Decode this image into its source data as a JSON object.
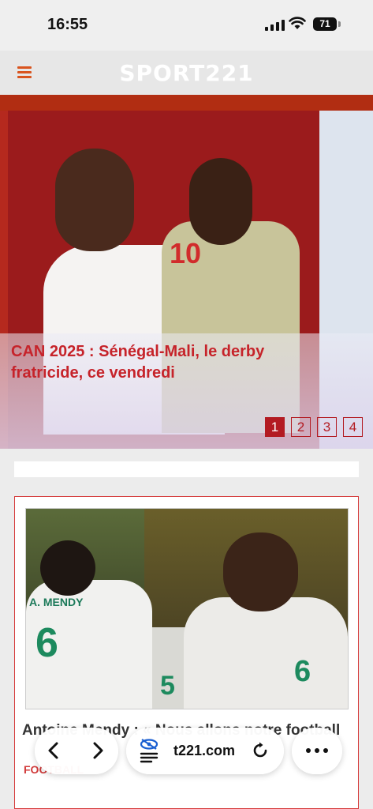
{
  "status_bar": {
    "time": "16:55",
    "battery": "71"
  },
  "header": {
    "site_name": "SPORT221",
    "menu_icon": "menu-icon"
  },
  "hero": {
    "headline": "CAN 2025 : Sénégal-Mali, le derby fratricide, ce vendredi",
    "jersey_number": "10",
    "pager": [
      "1",
      "2",
      "3",
      "4"
    ],
    "active_page": "1"
  },
  "article_card": {
    "title": "Antoine Mendy : « Nous allons notre football",
    "category": "FOOTBALL",
    "image_texts": {
      "shirt_name": "A. MENDY",
      "shirt_number": "6",
      "shirt_number_2": "5",
      "shirt_number_3": "6"
    }
  },
  "browser_toolbar": {
    "url": "t221.com",
    "back_icon": "chevron-left-icon",
    "forward_icon": "chevron-right-icon",
    "reader_icon": "reader-mode-icon",
    "reload_icon": "reload-icon",
    "more_icon": "more-icon"
  },
  "colors": {
    "accent": "#c6232a",
    "menu": "#d9541e",
    "header_bg": "#e7e7e7"
  }
}
